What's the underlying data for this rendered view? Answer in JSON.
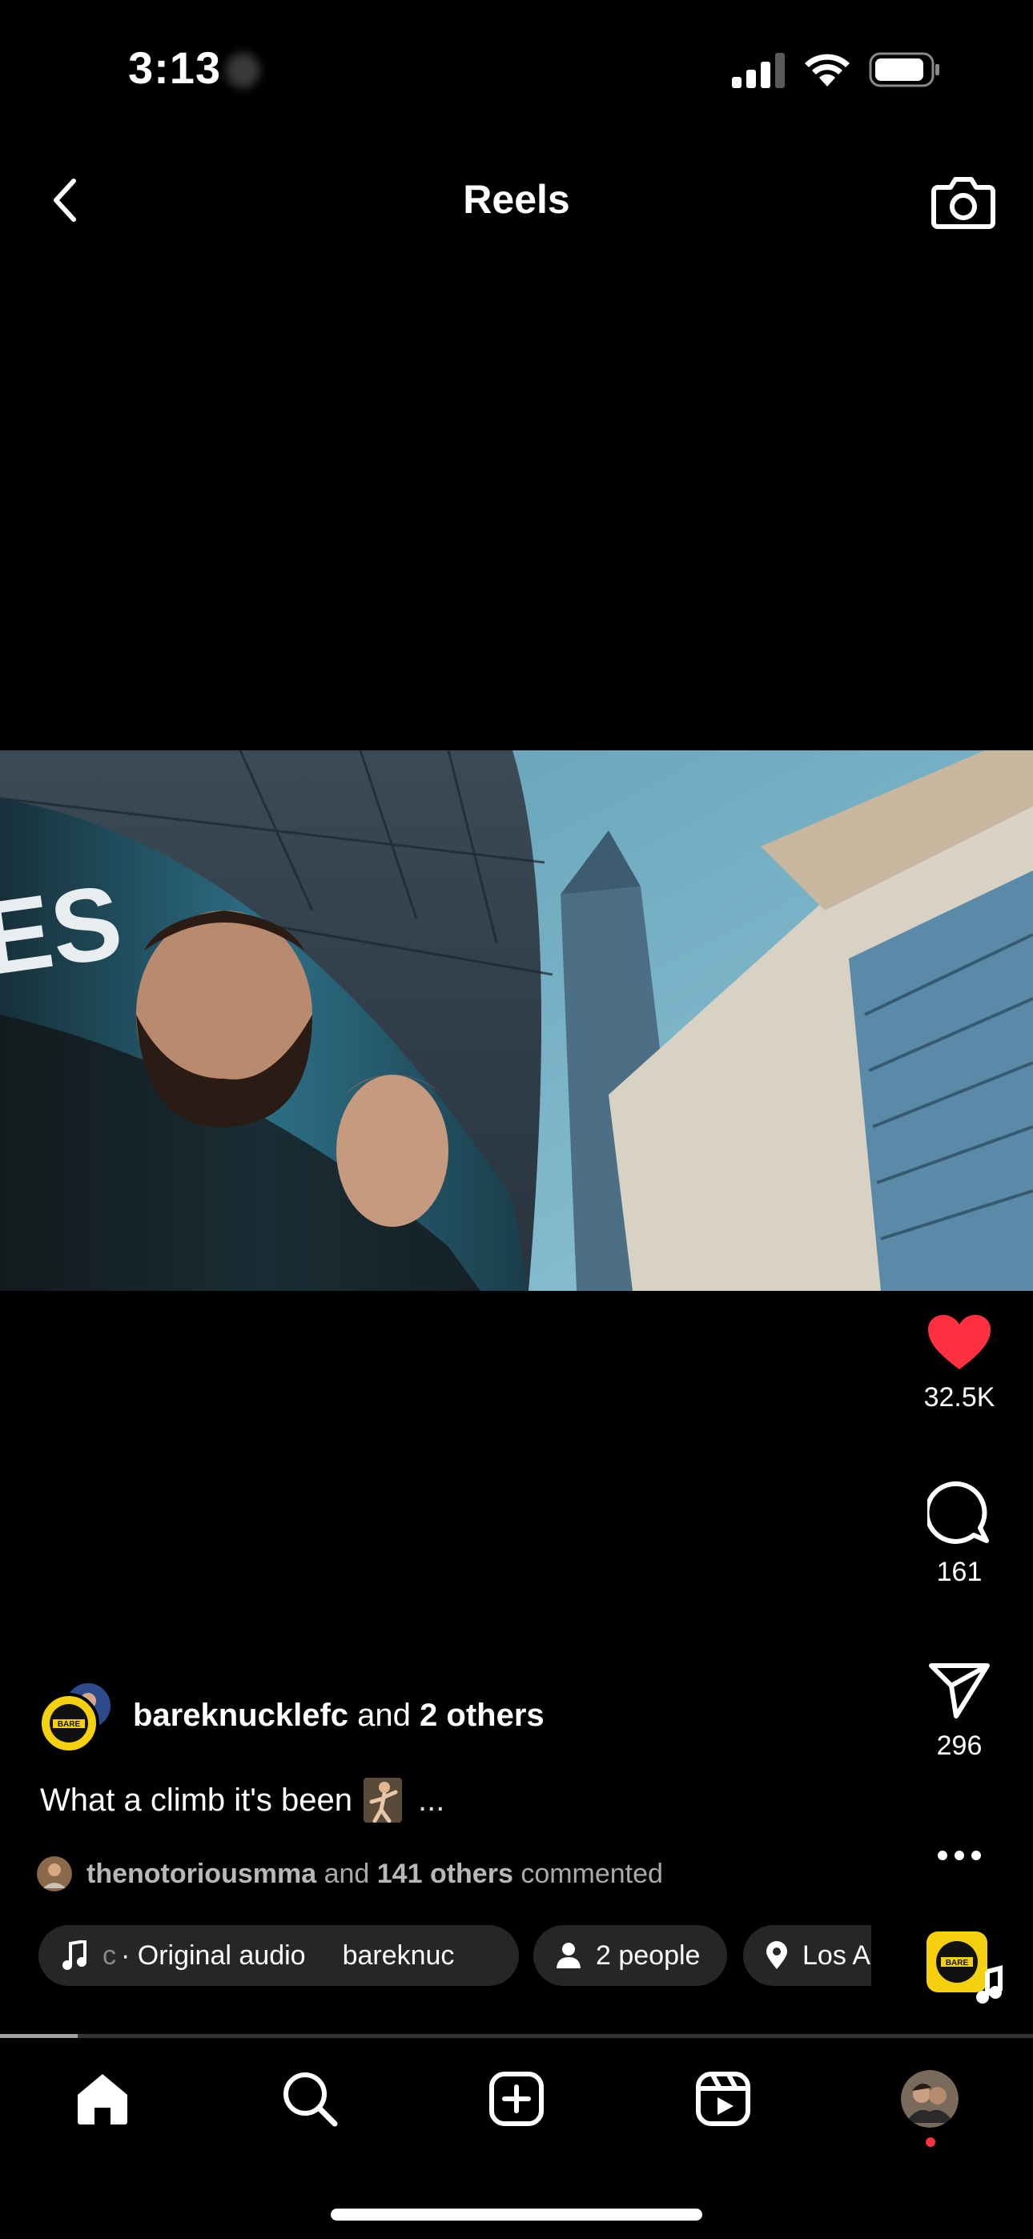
{
  "status_bar": {
    "time": "3:13"
  },
  "header": {
    "title": "Reels"
  },
  "reel": {
    "likes": "32.5K",
    "comments": "161",
    "shares": "296",
    "author": {
      "username": "bareknucklefc",
      "and_text": "and",
      "others": "2 others"
    },
    "caption": "What a climb it's been",
    "caption_more": "...",
    "commented": {
      "username": "thenotoriousmma",
      "and_text": "and",
      "others": "141 others",
      "suffix": "commented"
    },
    "audio_chip": {
      "prefix": "c",
      "label": "· Original audio",
      "artist": "bareknuc"
    },
    "people_chip": "2 people",
    "location_chip": "Los A",
    "playback_progress": 0.075
  },
  "colors": {
    "like": "#ff3040",
    "chip_bg": "#262626",
    "background": "#000000"
  },
  "tabs": [
    "home",
    "search",
    "create",
    "reels",
    "profile"
  ]
}
